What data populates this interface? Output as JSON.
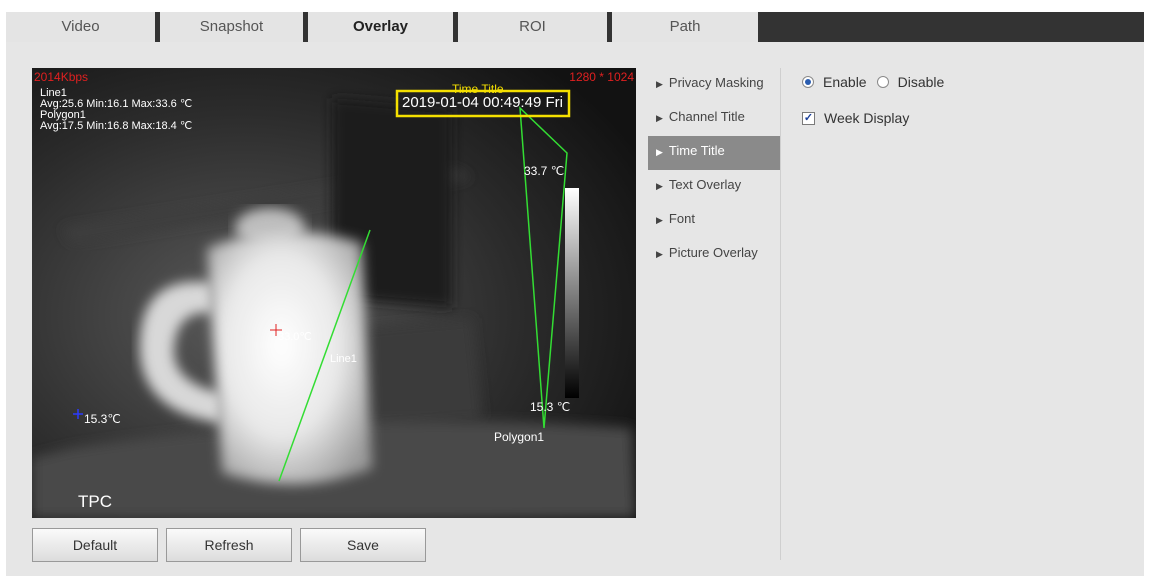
{
  "tabs": [
    {
      "label": "Video",
      "active": false
    },
    {
      "label": "Snapshot",
      "active": false
    },
    {
      "label": "Overlay",
      "active": true
    },
    {
      "label": "ROI",
      "active": false
    },
    {
      "label": "Path",
      "active": false
    }
  ],
  "video": {
    "bitrate": "2014Kbps",
    "resolution": "1280 * 1024",
    "line_name": "Line1",
    "line_stats": "Avg:25.6 Min:16.1 Max:33.6 ℃",
    "polygon_name": "Polygon1",
    "polygon_stats": "Avg:17.5 Min:16.8 Max:18.4 ℃",
    "timestamp": "2019-01-04 00:49:49 Fri",
    "time_title_label": "Time Title",
    "scale_max": "33.7 ℃",
    "scale_min": "15.3 ℃",
    "spot_hot": "33.0℃",
    "spot_cold": "15.3℃",
    "line_label": "Line1",
    "polygon_label": "Polygon1",
    "channel_title": "TPC"
  },
  "buttons": {
    "default": "Default",
    "refresh": "Refresh",
    "save": "Save"
  },
  "menu": [
    {
      "label": "Privacy Masking",
      "active": false
    },
    {
      "label": "Channel Title",
      "active": false
    },
    {
      "label": "Time Title",
      "active": true
    },
    {
      "label": "Text Overlay",
      "active": false
    },
    {
      "label": "Font",
      "active": false
    },
    {
      "label": "Picture Overlay",
      "active": false
    }
  ],
  "settings": {
    "enable_label": "Enable",
    "disable_label": "Disable",
    "enabled": true,
    "week_display_label": "Week Display",
    "week_display_checked": true
  },
  "colors": {
    "overlay_red": "#e02020",
    "roi_green": "#33dd33",
    "time_box_yellow": "#f5e000",
    "active_menu_bg": "#8a8a8a"
  }
}
